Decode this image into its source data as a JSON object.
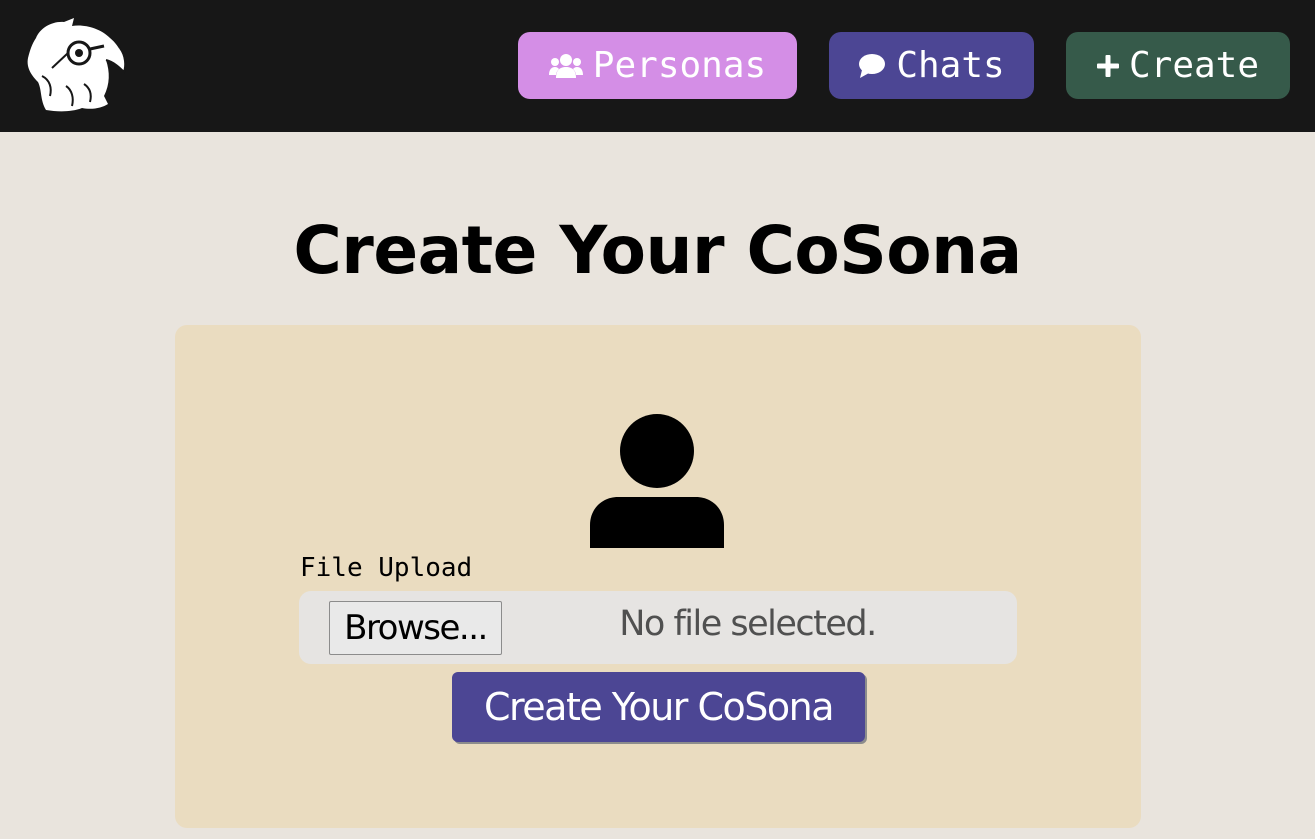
{
  "navbar": {
    "logo_icon": "parrot-with-monocle-icon",
    "personas": {
      "icon": "users-icon",
      "label": "Personas",
      "color": "#d48ee6"
    },
    "chats": {
      "icon": "speech-bubble-icon",
      "label": "Chats",
      "color": "#4c4694"
    },
    "create": {
      "icon": "plus-icon",
      "label": "Create",
      "color": "#365a4a"
    }
  },
  "main": {
    "title": "Create Your CoSona",
    "avatar_icon": "user-silhouette-icon",
    "file_upload": {
      "label": "File Upload",
      "browse_label": "Browse...",
      "status": "No file selected."
    },
    "submit_label": "Create Your CoSona"
  }
}
